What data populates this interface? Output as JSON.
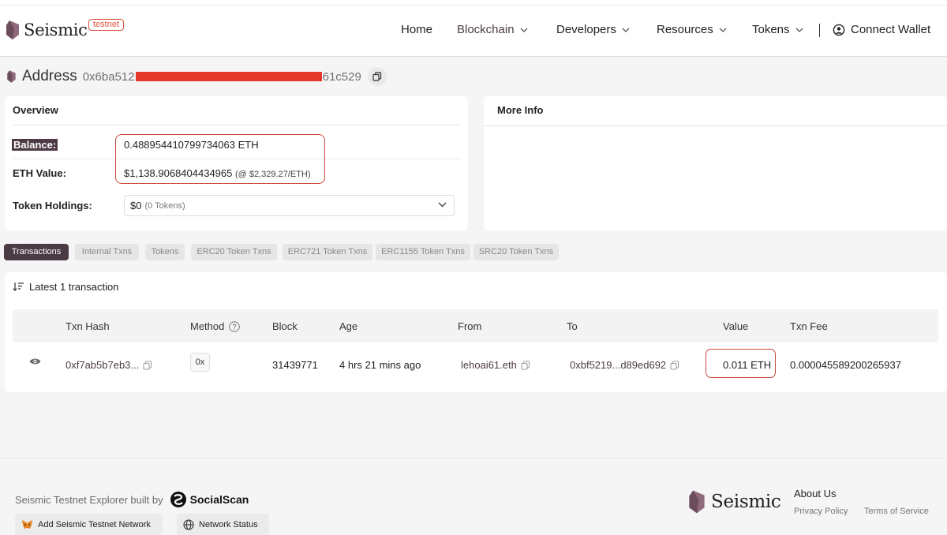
{
  "brand": {
    "name": "Seismic",
    "badge": "testnet"
  },
  "nav": {
    "items": [
      {
        "label": "Home",
        "has_dropdown": false
      },
      {
        "label": "Blockchain",
        "has_dropdown": true
      },
      {
        "label": "Developers",
        "has_dropdown": true
      },
      {
        "label": "Resources",
        "has_dropdown": true
      },
      {
        "label": "Tokens",
        "has_dropdown": true
      }
    ],
    "connect_wallet": "Connect Wallet"
  },
  "address": {
    "title": "Address",
    "prefix": "0x6ba512",
    "suffix": "61c529"
  },
  "overview": {
    "title": "Overview",
    "balance_label": "Balance:",
    "balance_value": "0.488954410799734063 ETH",
    "eth_value_label": "ETH Value:",
    "eth_value": "$1,138.9068404434965",
    "eth_price": "(@ $2,329.27/ETH)",
    "token_holdings_label": "Token Holdings:",
    "token_holdings_value": "$0",
    "token_holdings_count": "(0 Tokens)"
  },
  "more_info": {
    "title": "More Info"
  },
  "tabs": [
    {
      "label": "Transactions",
      "active": true
    },
    {
      "label": "Internal Txns",
      "active": false
    },
    {
      "label": "Tokens",
      "active": false
    },
    {
      "label": "ERC20 Token Txns",
      "active": false
    },
    {
      "label": "ERC721 Token Txns",
      "active": false
    },
    {
      "label": "ERC1155 Token Txns",
      "active": false
    },
    {
      "label": "SRC20 Token Txns",
      "active": false
    }
  ],
  "transactions": {
    "summary": "Latest 1 transaction",
    "columns": [
      "Txn Hash",
      "Method",
      "Block",
      "Age",
      "From",
      "To",
      "Value",
      "Txn Fee"
    ],
    "rows": [
      {
        "txn_hash": "0xf7ab5b7eb3...",
        "method": "0x",
        "block": "31439771",
        "age": "4 hrs 21 mins ago",
        "from": "lehoai61.eth",
        "to": "0xbf5219...d89ed692",
        "value": "0.011 ETH",
        "txn_fee": "0.000045589200265937"
      }
    ]
  },
  "footer": {
    "built_by": "Seismic Testnet Explorer built by",
    "builder": "SocialScan",
    "add_network": "Add Seismic Testnet Network",
    "network_status": "Network Status",
    "brand": "Seismic",
    "about": "About Us",
    "privacy": "Privacy Policy",
    "terms": "Terms of Service"
  },
  "colors": {
    "accent": "#4b3b45",
    "highlight_red": "#c9483a",
    "redaction": "#e4382c",
    "testnet_badge": "#e0533f"
  },
  "icons": {
    "logo": "seismic-logo-icon",
    "wallet": "user-circle-icon",
    "copy": "copy-icon",
    "sort": "sort-icon",
    "eye": "eye-icon",
    "help": "question-icon",
    "metamask": "metamask-fox-icon",
    "globe": "globe-icon"
  }
}
